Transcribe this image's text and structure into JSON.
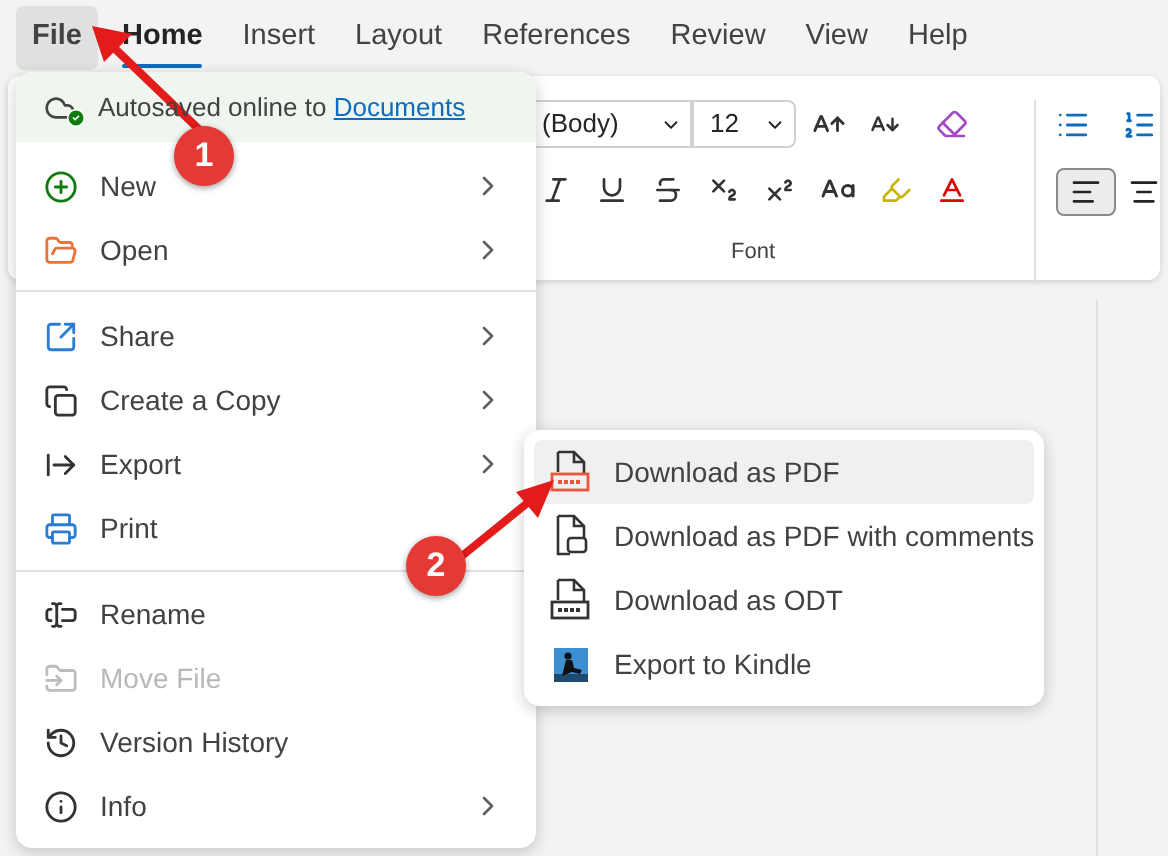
{
  "tabs": [
    {
      "label": "File",
      "selected": false,
      "open": true
    },
    {
      "label": "Home",
      "selected": true,
      "open": false
    },
    {
      "label": "Insert",
      "selected": false,
      "open": false
    },
    {
      "label": "Layout",
      "selected": false,
      "open": false
    },
    {
      "label": "References",
      "selected": false,
      "open": false
    },
    {
      "label": "Review",
      "selected": false,
      "open": false
    },
    {
      "label": "View",
      "selected": false,
      "open": false
    },
    {
      "label": "Help",
      "selected": false,
      "open": false
    }
  ],
  "ribbon": {
    "font_name": "(Body)",
    "font_size": "12",
    "group_label": "Font"
  },
  "file_menu": {
    "autosave": {
      "text": "Autosaved online to",
      "link": "Documents"
    },
    "groups": [
      [
        {
          "label": "New",
          "submenu": true,
          "disabled": false
        },
        {
          "label": "Open",
          "submenu": true,
          "disabled": false
        }
      ],
      [
        {
          "label": "Share",
          "submenu": true,
          "disabled": false
        },
        {
          "label": "Create a Copy",
          "submenu": true,
          "disabled": false
        },
        {
          "label": "Export",
          "submenu": true,
          "disabled": false
        },
        {
          "label": "Print",
          "submenu": false,
          "disabled": false
        }
      ],
      [
        {
          "label": "Rename",
          "submenu": false,
          "disabled": false
        },
        {
          "label": "Move File",
          "submenu": false,
          "disabled": true
        },
        {
          "label": "Version History",
          "submenu": false,
          "disabled": false
        },
        {
          "label": "Info",
          "submenu": true,
          "disabled": false
        }
      ]
    ]
  },
  "export_menu": [
    {
      "label": "Download as PDF",
      "selected": true
    },
    {
      "label": "Download as PDF with comments",
      "selected": false
    },
    {
      "label": "Download as ODT",
      "selected": false
    },
    {
      "label": "Export to Kindle",
      "selected": false
    }
  ],
  "callouts": [
    {
      "label": "1"
    },
    {
      "label": "2"
    }
  ]
}
